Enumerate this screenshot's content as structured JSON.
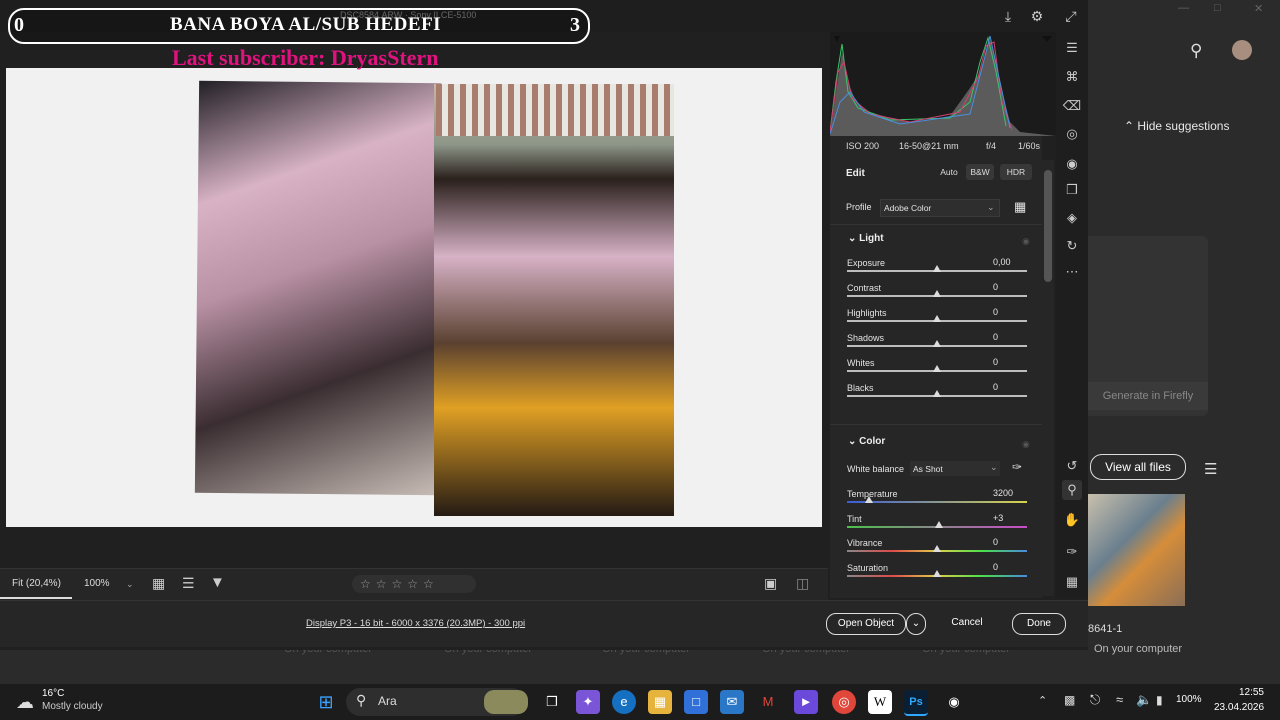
{
  "app": {
    "file_title": "DSC8584.ARW · Sony ILCE-5100"
  },
  "overlay": {
    "left_count": "0",
    "title": "BANA BOYA AL/SUB HEDEFI",
    "right_count": "3",
    "last_subscriber": "Last subscriber: DryasStern"
  },
  "camera_info": {
    "iso": "ISO 200",
    "lens": "16-50@21 mm",
    "aperture": "f/4",
    "shutter": "1/60s"
  },
  "edit": {
    "title": "Edit",
    "auto": "Auto",
    "bw": "B&W",
    "hdr": "HDR",
    "profile_label": "Profile",
    "profile_value": "Adobe Color"
  },
  "light": {
    "title": "Light",
    "sliders": [
      {
        "label": "Exposure",
        "value": "0,00",
        "position": 0.5
      },
      {
        "label": "Contrast",
        "value": "0",
        "position": 0.5
      },
      {
        "label": "Highlights",
        "value": "0",
        "position": 0.5
      },
      {
        "label": "Shadows",
        "value": "0",
        "position": 0.5
      },
      {
        "label": "Whites",
        "value": "0",
        "position": 0.5
      },
      {
        "label": "Blacks",
        "value": "0",
        "position": 0.5
      }
    ]
  },
  "color": {
    "title": "Color",
    "wb_label": "White balance",
    "wb_value": "As Shot",
    "sliders": [
      {
        "label": "Temperature",
        "value": "3200",
        "position": 0.12
      },
      {
        "label": "Tint",
        "value": "+3",
        "position": 0.51
      },
      {
        "label": "Vibrance",
        "value": "0",
        "position": 0.5
      },
      {
        "label": "Saturation",
        "value": "0",
        "position": 0.5
      }
    ]
  },
  "bottom": {
    "fit": "Fit (20,4%)",
    "zoom": "100%",
    "display_info": "Display P3 - 16 bit - 6000 x 3376 (20.3MP) - 300 ppi",
    "open_object": "Open Object",
    "cancel": "Cancel",
    "done": "Done",
    "rating_stars": "☆☆☆☆☆"
  },
  "background": {
    "hide_suggestions": "Hide suggestions",
    "generate": "Generate in Firefly",
    "view_all": "View all files",
    "thumb_name": "8641-1",
    "thumb_location": "On your computer",
    "strip_location": "On your computer"
  },
  "taskbar": {
    "temp": "16°C",
    "weather": "Mostly cloudy",
    "search": "Ara",
    "battery": "100%",
    "time": "12:55",
    "date": "23.04.2026"
  }
}
